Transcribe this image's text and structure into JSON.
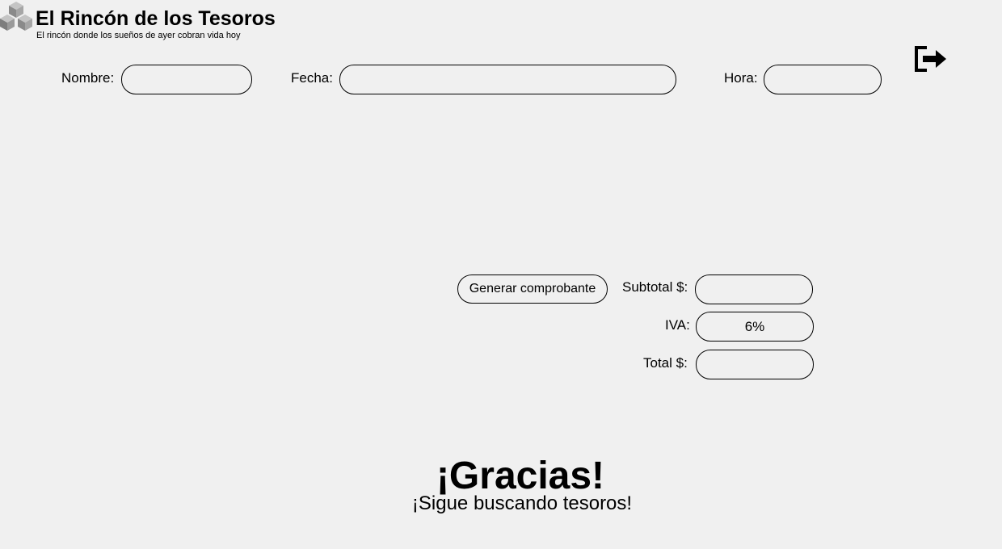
{
  "header": {
    "title": "El Rincón de los Tesoros",
    "subtitle": "El rincón donde los sueños de ayer cobran vida hoy",
    "logo_icon": "stacked-cubes-icon",
    "exit_icon": "logout-icon"
  },
  "form": {
    "nombre_label": "Nombre:",
    "nombre_value": "",
    "fecha_label": "Fecha:",
    "fecha_value": "",
    "hora_label": "Hora:",
    "hora_value": ""
  },
  "summary": {
    "generate_button": "Generar comprobante",
    "subtotal_label": "Subtotal $:",
    "subtotal_value": "",
    "iva_label": "IVA:",
    "iva_value": "6%",
    "total_label": "Total $:",
    "total_value": ""
  },
  "footer": {
    "thanks": "¡Gracias!",
    "message": "¡Sigue buscando tesoros!"
  }
}
